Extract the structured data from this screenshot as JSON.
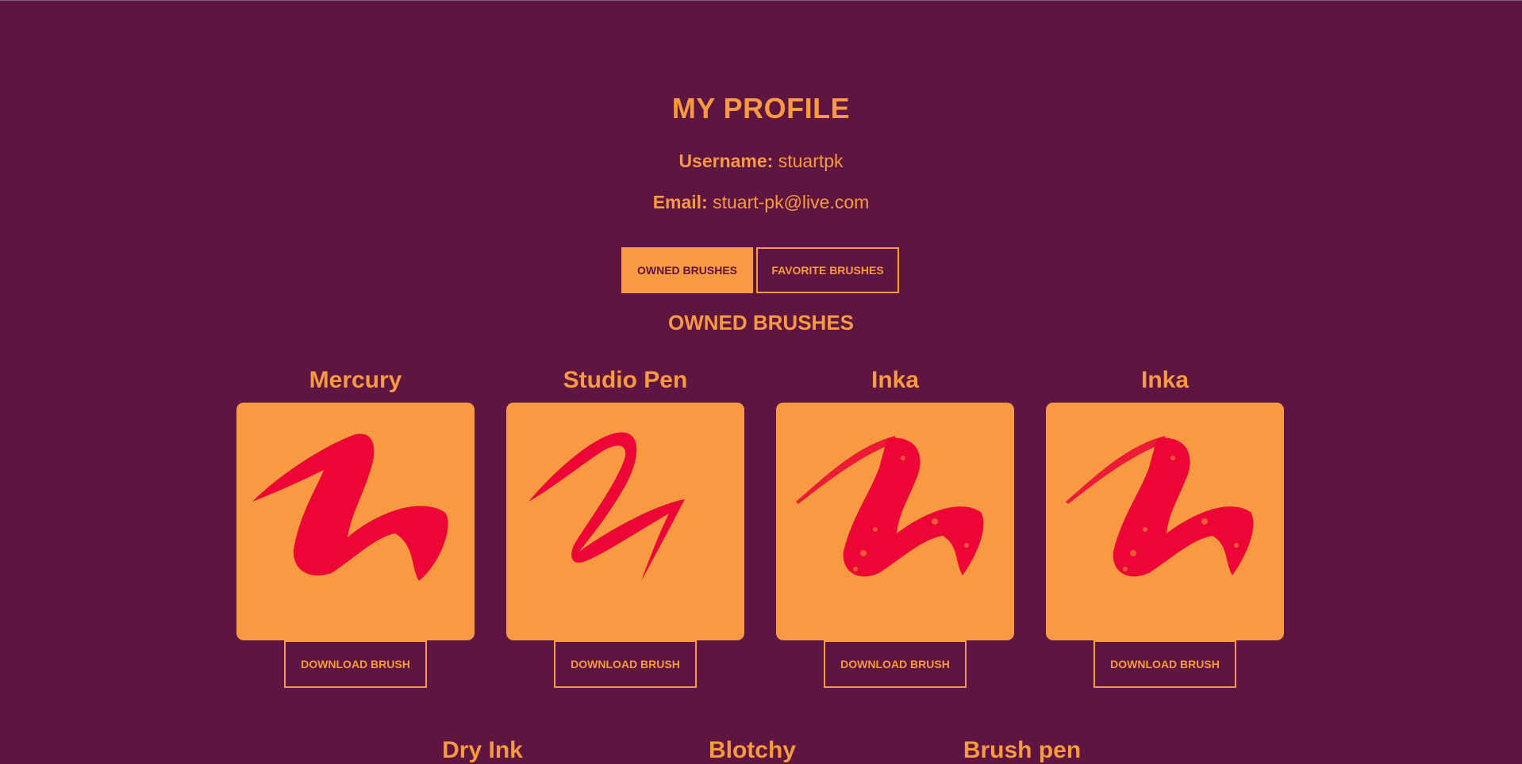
{
  "profile": {
    "title": "MY PROFILE",
    "username_label": "Username:",
    "username": "stuartpk",
    "email_label": "Email:",
    "email": "stuart-pk@live.com"
  },
  "tabs": [
    {
      "label": "OWNED BRUSHES",
      "active": true
    },
    {
      "label": "FAVORITE BRUSHES",
      "active": false
    }
  ],
  "section_heading": "OWNED BRUSHES",
  "brushes": [
    {
      "name": "Mercury",
      "style": "solid-thick",
      "download_label": "DOWNLOAD BRUSH"
    },
    {
      "name": "Studio Pen",
      "style": "smooth-tapered",
      "download_label": "DOWNLOAD BRUSH"
    },
    {
      "name": "Inka",
      "style": "textured",
      "download_label": "DOWNLOAD BRUSH"
    },
    {
      "name": "Inka",
      "style": "textured",
      "download_label": "DOWNLOAD BRUSH"
    }
  ],
  "more_brushes": [
    "Dry Ink",
    "Blotchy",
    "Brush pen"
  ],
  "colors": {
    "background": "#5e1540",
    "accent": "#f79a41",
    "stroke": "#ec0535"
  }
}
